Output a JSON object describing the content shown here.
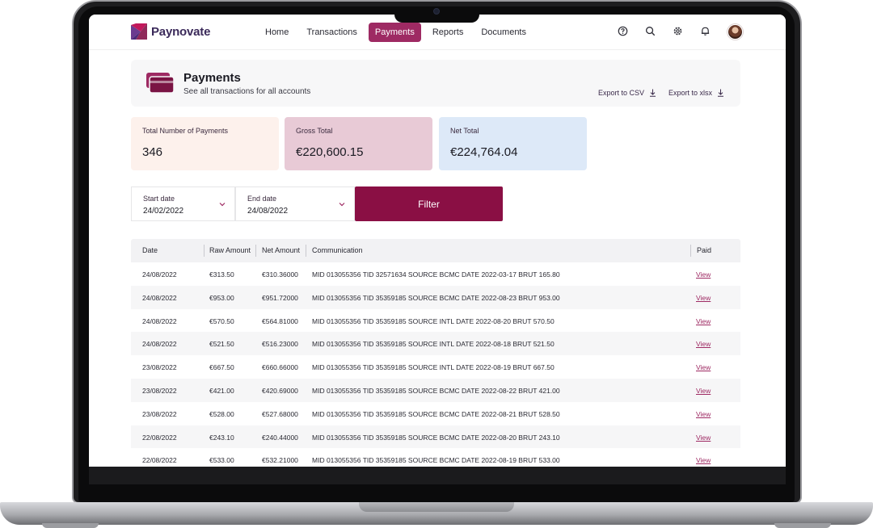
{
  "app": {
    "name": "Paynovate"
  },
  "nav": {
    "items": [
      {
        "label": "Home",
        "active": false
      },
      {
        "label": "Transactions",
        "active": false
      },
      {
        "label": "Payments",
        "active": true
      },
      {
        "label": "Reports",
        "active": false
      },
      {
        "label": "Documents",
        "active": false
      }
    ]
  },
  "toolbar_icons": [
    "help-icon",
    "search-icon",
    "gear-icon",
    "bell-icon"
  ],
  "page": {
    "title": "Payments",
    "subtitle": "See all transactions for all accounts",
    "export_csv": "Export to CSV",
    "export_xlsx": "Export to xlsx"
  },
  "stats": [
    {
      "label": "Total Number of Payments",
      "value": "346",
      "color": "#fdf1ec"
    },
    {
      "label": "Gross Total",
      "value": "€220,600.15",
      "color": "#e8cad6"
    },
    {
      "label": "Net Total",
      "value": "€224,764.04",
      "color": "#dde9f8"
    }
  ],
  "filters": {
    "start_label": "Start date",
    "start_value": "24/02/2022",
    "end_label": "End date",
    "end_value": "24/08/2022",
    "button_label": "Filter"
  },
  "table": {
    "headers": [
      "Date",
      "Raw Amount",
      "Net Amount",
      "Communication",
      "Paid"
    ],
    "rows": [
      [
        "24/08/2022",
        "€313.50",
        "€310.36000",
        "MID 013055356 TID 32571634 SOURCE BCMC DATE 2022-03-17 BRUT 165.80",
        "View"
      ],
      [
        "24/08/2022",
        "€953.00",
        "€951.72000",
        "MID 013055356 TID 35359185 SOURCE BCMC DATE 2022-08-23 BRUT 953.00",
        "View"
      ],
      [
        "24/08/2022",
        "€570.50",
        "€564.81000",
        "MID 013055356 TID 35359185 SOURCE INTL DATE 2022-08-20 BRUT 570.50",
        "View"
      ],
      [
        "24/08/2022",
        "€521.50",
        "€516.23000",
        "MID 013055356 TID 35359185 SOURCE INTL DATE 2022-08-18 BRUT 521.50",
        "View"
      ],
      [
        "23/08/2022",
        "€667.50",
        "€660.66000",
        "MID 013055356 TID 35359185 SOURCE INTL DATE 2022-08-19 BRUT 667.50",
        "View"
      ],
      [
        "23/08/2022",
        "€421.00",
        "€420.69000",
        "MID 013055356 TID 35359185 SOURCE BCMC DATE 2022-08-22 BRUT 421.00",
        "View"
      ],
      [
        "23/08/2022",
        "€528.00",
        "€527.68000",
        "MID 013055356 TID 35359185 SOURCE BCMC DATE 2022-08-21 BRUT 528.50",
        "View"
      ],
      [
        "22/08/2022",
        "€243.10",
        "€240.44000",
        "MID 013055356 TID 35359185 SOURCE BCMC DATE 2022-08-20 BRUT 243.10",
        "View"
      ],
      [
        "22/08/2022",
        "€533.00",
        "€532.21000",
        "MID 013055356 TID 35359185 SOURCE BCMC DATE 2022-08-19 BRUT 533.00",
        "View"
      ]
    ]
  },
  "colors": {
    "accent": "#9e2a63",
    "filter_button": "#8a0f44",
    "logo": "#3b2a5a"
  }
}
